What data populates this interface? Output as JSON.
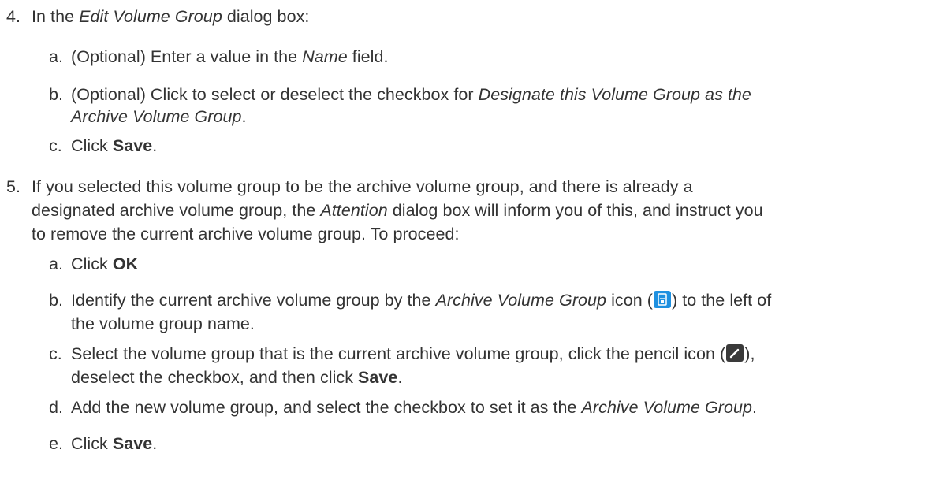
{
  "step4": {
    "num": "4.",
    "intro_pre": "In the ",
    "intro_em": "Edit Volume Group",
    "intro_post": " dialog box:",
    "a": {
      "letter": "a.",
      "pre": "(Optional) Enter a value in the ",
      "em": "Name",
      "post": " field."
    },
    "b": {
      "letter": "b.",
      "pre": "(Optional) Click to select or deselect the checkbox for ",
      "em1": "Designate this Volume Group as the",
      "em2": "Archive Volume Group",
      "post": "."
    },
    "c": {
      "letter": "c.",
      "pre": "Click ",
      "strong": "Save",
      "post": "."
    }
  },
  "step5": {
    "num": "5.",
    "line1": "If you selected this volume group to be the archive volume group, and there is already a",
    "line2_pre": "designated archive volume group, the ",
    "line2_em": "Attention",
    "line2_post": " dialog box will inform you of this, and instruct you",
    "line3": "to remove the current archive volume group. To proceed:",
    "a": {
      "letter": "a.",
      "pre": "Click ",
      "strong": "OK"
    },
    "b": {
      "letter": "b.",
      "pre": "Identify the current archive volume group by the ",
      "em": "Archive Volume Group",
      "mid": " icon (",
      "icon": "archive-volume-group-icon",
      "post": ") to the left of",
      "line2": "the volume group name."
    },
    "c": {
      "letter": "c.",
      "pre": "Select the volume group that is the current archive volume group, click the pencil icon (",
      "icon": "pencil-icon",
      "post": "),",
      "line2_pre": "deselect the checkbox, and then click ",
      "line2_strong": "Save",
      "line2_post": "."
    },
    "d": {
      "letter": "d.",
      "pre": "Add the new volume group, and select the checkbox to set it as the ",
      "em": "Archive Volume Group",
      "post": "."
    },
    "e": {
      "letter": "e.",
      "pre": "Click ",
      "strong": "Save",
      "post": "."
    }
  },
  "colors": {
    "text": "#333333",
    "archive_icon": "#1e90e0",
    "pencil_icon": "#3a3a3a"
  }
}
